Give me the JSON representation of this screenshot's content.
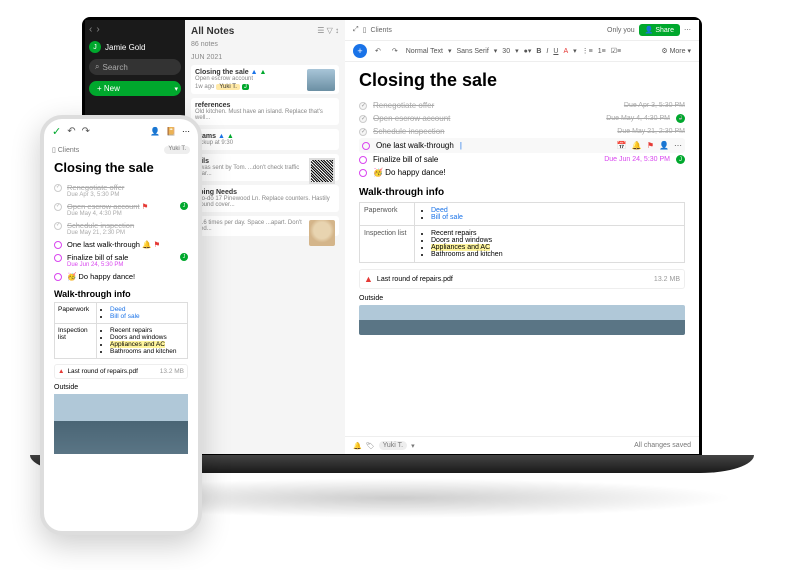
{
  "sidebar": {
    "user_initial": "J",
    "user_name": "Jamie Gold",
    "search_placeholder": "Search",
    "new_label": "+ New"
  },
  "notelist": {
    "title": "All Notes",
    "count": "86 notes",
    "month": "JUN 2021",
    "cards": [
      {
        "title": "Closing the sale",
        "sub": "Open escrow account",
        "time_ago": "1w ago",
        "tag": "Yuki T."
      },
      {
        "title": "references",
        "sub": "Old kitchen. Must have an island. Replace that's well..."
      },
      {
        "title": "grams",
        "sub": "Pickup at 9:30"
      },
      {
        "title": "tails",
        "sub": "...was sent by Tom. ...don't check traffic near..."
      },
      {
        "title": "oping Needs",
        "sub": "...to-do 17 Pinewood Ln. Replace counters. Hastily ground cover..."
      },
      {
        "title": "",
        "sub": "3...6 times per day. Space ...apart. Don't feed..."
      }
    ]
  },
  "breadcrumb": {
    "notebook": "Clients",
    "only_you": "Only you",
    "share": "Share"
  },
  "toolbar": {
    "style": "Normal Text",
    "font": "Sans Serif",
    "size": "30",
    "more": "More"
  },
  "note": {
    "title": "Closing the sale",
    "tasks": [
      {
        "text": "Renegotiate offer",
        "due": "Due Apr 3, 5:30 PM",
        "state": "done",
        "strike": true
      },
      {
        "text": "Open escrow account",
        "due": "Due May 4, 4:30 PM",
        "state": "done",
        "strike": true,
        "j": true
      },
      {
        "text": "Schedule inspection",
        "due": "Due May 21, 2:30 PM",
        "state": "done",
        "strike": true
      },
      {
        "text": "One last walk-through",
        "due": "",
        "state": "open",
        "active": true
      },
      {
        "text": "Finalize bill of sale",
        "due": "Due Jun 24, 5:30 PM",
        "state": "open",
        "j": true
      },
      {
        "text": "🥳 Do happy dance!",
        "due": "",
        "state": "open"
      }
    ],
    "section": "Walk-through info",
    "paperwork_label": "Paperwork",
    "paperwork": [
      "Deed",
      "Bill of sale"
    ],
    "inspection_label": "Inspection list",
    "inspection": [
      "Recent repairs",
      "Doors and windows",
      "Appliances and AC",
      "Bathrooms and kitchen"
    ],
    "attachment": "Last round of repairs.pdf",
    "attachment_size": "13.2 MB",
    "outside": "Outside",
    "bottom_user": "Yuki T.",
    "saved": "All changes saved"
  },
  "phone": {
    "crumb": "Clients",
    "yuki": "Yuki T.",
    "title": "Closing the sale",
    "tasks": [
      {
        "t": "Renegotiate offer",
        "d": "Due Apr 3, 5:30 PM",
        "s": "d",
        "strike": true
      },
      {
        "t": "Open escrow account",
        "d": "Due May 4, 4:30 PM",
        "s": "d",
        "strike": true,
        "flag": true,
        "j": true
      },
      {
        "t": "Schedule inspection",
        "d": "Due May 21, 2:30 PM",
        "s": "d",
        "strike": true
      },
      {
        "t": "One last walk-through",
        "d": "",
        "s": "o",
        "bell": true,
        "flag": true
      },
      {
        "t": "Finalize bill of sale",
        "d": "Due Jun 24, 5:30 PM",
        "s": "o",
        "due_pink": true,
        "j": true
      },
      {
        "t": "🥳 Do happy dance!",
        "d": "",
        "s": "o"
      }
    ],
    "section": "Walk-through info",
    "paperwork_label": "Paperwork",
    "paperwork": [
      "Deed",
      "Bill of sale"
    ],
    "inspection_label": "Inspection list",
    "inspection": [
      "Recent repairs",
      "Doors and windows",
      "Appliances and AC",
      "Bathrooms and kitchen"
    ],
    "attachment": "Last round of repairs.pdf",
    "attachment_size": "13.2 MB",
    "outside": "Outside"
  }
}
